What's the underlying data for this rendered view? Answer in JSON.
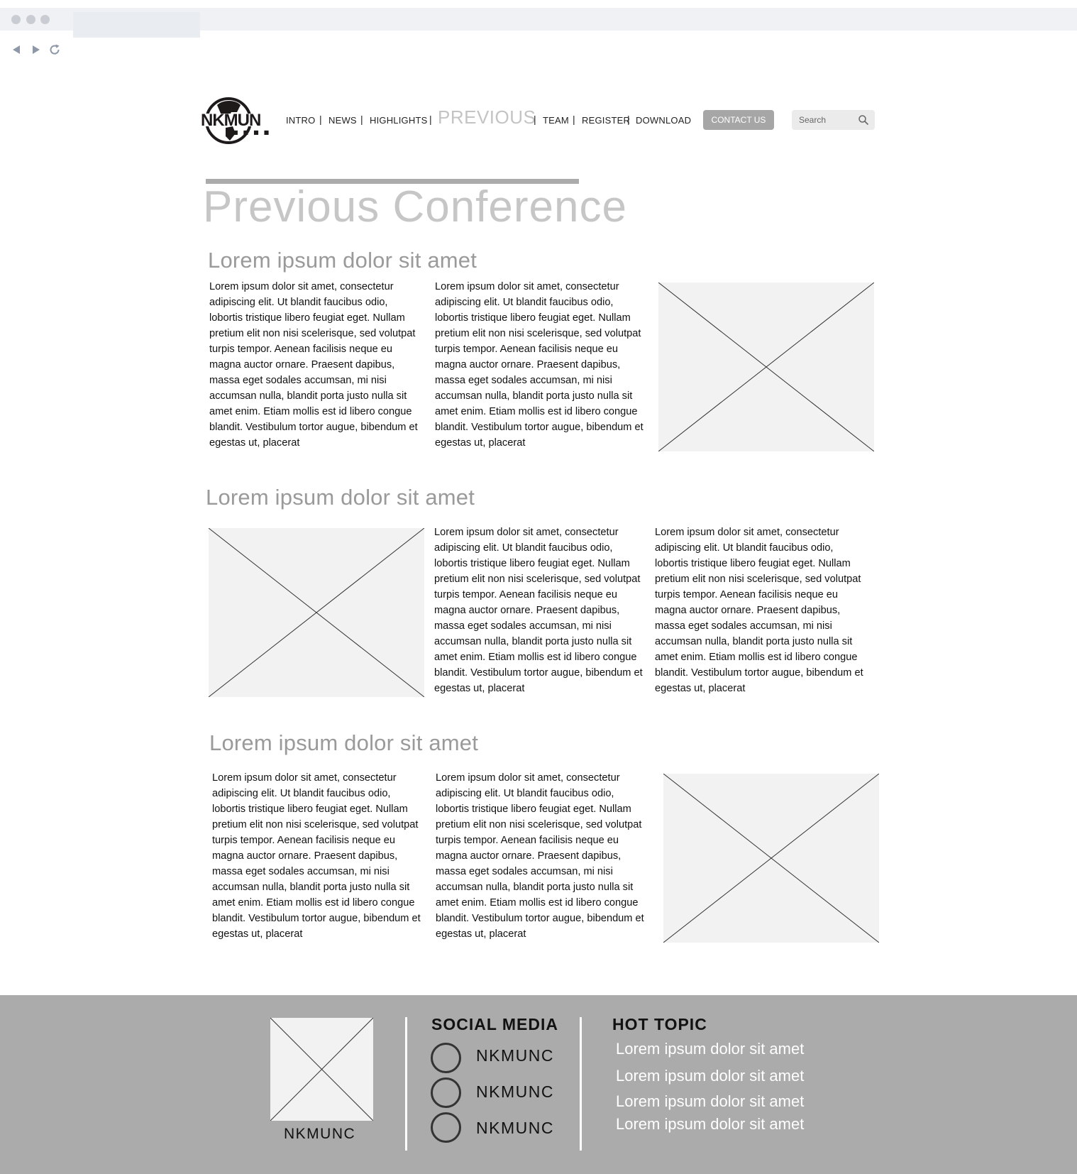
{
  "browser": {
    "controls": [
      "back-icon",
      "forward-icon",
      "reload-icon"
    ]
  },
  "header": {
    "logo_text": "NKMUN",
    "nav": {
      "intro": "INTRO",
      "news": "NEWS",
      "highlights": "HIGHLIGHTS",
      "previous": "PREVIOUS",
      "team": "TEAM",
      "register": "REGISTER",
      "download": "DOWNLOAD",
      "separator": "|"
    },
    "contact_label": "CONTACT US",
    "search_placeholder": "Search"
  },
  "page": {
    "title": "Previous Conference"
  },
  "body_text": "Lorem ipsum dolor sit amet, consectetur adipiscing elit. Ut blandit faucibus odio, lobortis tristique libero feugiat eget. Nullam pretium elit non nisi scelerisque, sed volutpat turpis tempor. Aenean facilisis neque eu magna auctor ornare. Praesent dapibus, massa eget sodales accumsan, mi nisi accumsan nulla, blandit porta justo nulla sit amet enim. Etiam mollis est id libero congue blandit. Vestibulum tortor augue, bibendum et egestas ut, placerat",
  "sections": [
    {
      "heading": "Lorem ipsum dolor sit amet",
      "col1": "Lorem ipsum dolor sit amet, consectetur adipiscing elit. Ut blandit faucibus odio, lobortis tristique libero feugiat eget. Nullam pretium elit non nisi scelerisque, sed volutpat turpis tempor. Aenean facilisis neque eu magna auctor ornare. Praesent dapibus, massa eget sodales accumsan, mi nisi accumsan nulla, blandit porta justo nulla sit amet enim. Etiam mollis est id libero congue blandit. Vestibulum tortor augue, bibendum et egestas ut, placerat",
      "col2": "Lorem ipsum dolor sit amet, consectetur adipiscing elit. Ut blandit faucibus odio, lobortis tristique libero feugiat eget. Nullam pretium elit non nisi scelerisque, sed volutpat turpis tempor. Aenean facilisis neque eu magna auctor ornare. Praesent dapibus, massa eget sodales accumsan, mi nisi accumsan nulla, blandit porta justo nulla sit amet enim. Etiam mollis est id libero congue blandit. Vestibulum tortor augue, bibendum et egestas ut, placerat"
    },
    {
      "heading": "Lorem ipsum dolor sit amet",
      "col1": "Lorem ipsum dolor sit amet, consectetur adipiscing elit. Ut blandit faucibus odio, lobortis tristique libero feugiat eget. Nullam pretium elit non nisi scelerisque, sed volutpat turpis tempor. Aenean facilisis neque eu magna auctor ornare. Praesent dapibus, massa eget sodales accumsan, mi nisi accumsan nulla, blandit porta justo nulla sit amet enim. Etiam mollis est id libero congue blandit. Vestibulum tortor augue, bibendum et egestas ut, placerat",
      "col2": "Lorem ipsum dolor sit amet, consectetur adipiscing elit. Ut blandit faucibus odio, lobortis tristique libero feugiat eget. Nullam pretium elit non nisi scelerisque, sed volutpat turpis tempor. Aenean facilisis neque eu magna auctor ornare. Praesent dapibus, massa eget sodales accumsan, mi nisi accumsan nulla, blandit porta justo nulla sit amet enim. Etiam mollis est id libero congue blandit. Vestibulum tortor augue, bibendum et egestas ut, placerat"
    },
    {
      "heading": "Lorem ipsum dolor sit amet",
      "col1": "Lorem ipsum dolor sit amet, consectetur adipiscing elit. Ut blandit faucibus odio, lobortis tristique libero feugiat eget. Nullam pretium elit non nisi scelerisque, sed volutpat turpis tempor. Aenean facilisis neque eu magna auctor ornare. Praesent dapibus, massa eget sodales accumsan, mi nisi accumsan nulla, blandit porta justo nulla sit amet enim. Etiam mollis est id libero congue blandit. Vestibulum tortor augue, bibendum et egestas ut, placerat",
      "col2": "Lorem ipsum dolor sit amet, consectetur adipiscing elit. Ut blandit faucibus odio, lobortis tristique libero feugiat eget. Nullam pretium elit non nisi scelerisque, sed volutpat turpis tempor. Aenean facilisis neque eu magna auctor ornare. Praesent dapibus, massa eget sodales accumsan, mi nisi accumsan nulla, blandit porta justo nulla sit amet enim. Etiam mollis est id libero congue blandit. Vestibulum tortor augue, bibendum et egestas ut, placerat"
    }
  ],
  "footer": {
    "brand": "NKMUNC",
    "social_heading": "SOCIAL MEDIA",
    "social": [
      "NKMUNC",
      "NKMUNC",
      "NKMUNC"
    ],
    "hot_heading": "HOT TOPIC",
    "hot_topics": [
      "Lorem ipsum dolor sit amet",
      "Lorem ipsum dolor sit amet",
      "Lorem ipsum dolor sit amet",
      "Lorem ipsum dolor sit amet"
    ]
  },
  "colors": {
    "footer_bg": "#ababab",
    "placeholder_bg": "#f2f2f2",
    "heading_gray": "#9a9a9a",
    "title_gray": "#c6c6c6",
    "contact_button": "#a6a6a6"
  }
}
